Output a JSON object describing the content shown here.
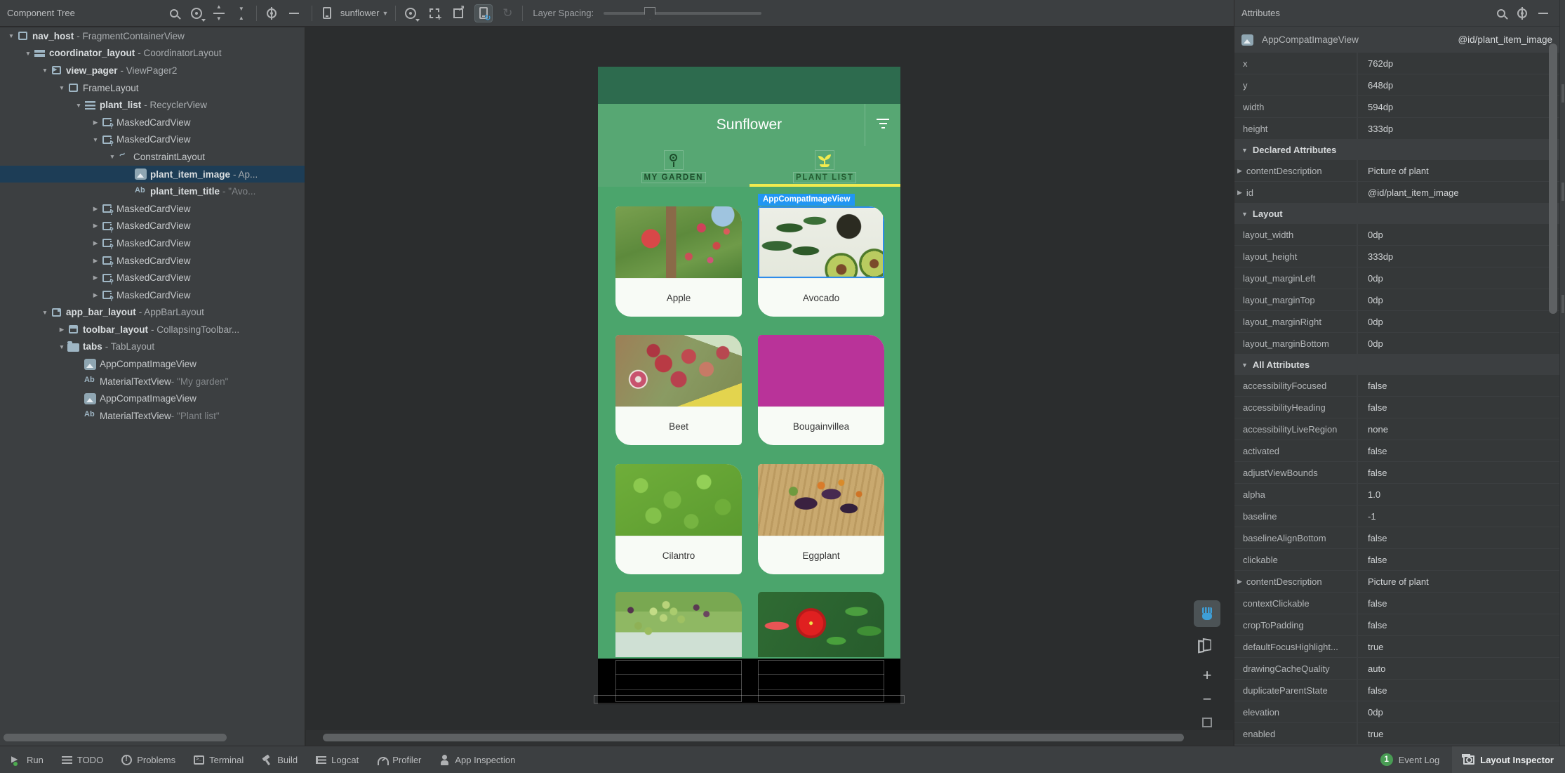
{
  "colors": {
    "panel_bg": "#3c3f41",
    "canvas_bg": "#2b2d2e",
    "selection_blue": "#1d3d56",
    "accent_blue": "#2196f3",
    "app_green": "#4ba56c",
    "appbar_green": "#57a773",
    "statusbar_green": "#2d6b4e",
    "tab_indicator_yellow": "#f0ea4f",
    "badge_green": "#499c54"
  },
  "toolbar": {
    "component_tree_title": "Component Tree",
    "tree_icons": [
      "search-icon",
      "view-options-icon",
      "expand-all-icon",
      "collapse-all-icon",
      "settings-icon",
      "hide-icon"
    ],
    "device_name": "sunflower",
    "center_icons": [
      "view-options-icon",
      "pick-target-icon",
      "export-icon",
      "live-updates-toggle",
      "refresh-icon"
    ],
    "layer_spacing_label": "Layer Spacing:"
  },
  "component_tree": {
    "items": [
      {
        "arrow": "open",
        "icon": "box",
        "label": "nav_host",
        "type": "FragmentContainerView",
        "level": 0
      },
      {
        "arrow": "open",
        "icon": "coord",
        "label": "coordinator_layout",
        "type": "CoordinatorLayout",
        "level": 1
      },
      {
        "arrow": "open",
        "icon": "pager",
        "label": "view_pager",
        "type": "ViewPager2",
        "level": 2
      },
      {
        "arrow": "open",
        "icon": "box",
        "label": "",
        "type": "FrameLayout",
        "level": 3
      },
      {
        "arrow": "open",
        "icon": "list",
        "label": "plant_list",
        "type": "RecyclerView",
        "level": 4
      },
      {
        "arrow": "closed",
        "icon": "card",
        "label": "",
        "type": "MaskedCardView",
        "level": 5
      },
      {
        "arrow": "open",
        "icon": "card",
        "label": "",
        "type": "MaskedCardView",
        "level": 5
      },
      {
        "arrow": "open",
        "icon": "constraint",
        "label": "",
        "type": "ConstraintLayout",
        "level": 6
      },
      {
        "arrow": "none",
        "icon": "img",
        "label": "plant_item_image",
        "type": "Ap...",
        "level": 7,
        "selected": true
      },
      {
        "arrow": "none",
        "icon": "text",
        "label": "plant_item_title",
        "string": "\"Avo...",
        "level": 7
      },
      {
        "arrow": "closed",
        "icon": "card",
        "label": "",
        "type": "MaskedCardView",
        "level": 5
      },
      {
        "arrow": "closed",
        "icon": "card",
        "label": "",
        "type": "MaskedCardView",
        "level": 5
      },
      {
        "arrow": "closed",
        "icon": "card",
        "label": "",
        "type": "MaskedCardView",
        "level": 5
      },
      {
        "arrow": "closed",
        "icon": "card",
        "label": "",
        "type": "MaskedCardView",
        "level": 5
      },
      {
        "arrow": "closed",
        "icon": "card",
        "label": "",
        "type": "MaskedCardView",
        "level": 5
      },
      {
        "arrow": "closed",
        "icon": "card",
        "label": "",
        "type": "MaskedCardView",
        "level": 5
      },
      {
        "arrow": "open",
        "icon": "appbar",
        "label": "app_bar_layout",
        "type": "AppBarLayout",
        "level": 2
      },
      {
        "arrow": "closed",
        "icon": "toolbar",
        "label": "toolbar_layout",
        "type": "CollapsingToolbar...",
        "level": 3
      },
      {
        "arrow": "open",
        "icon": "folder",
        "label": "tabs",
        "type": "TabLayout",
        "level": 3
      },
      {
        "arrow": "none",
        "icon": "img",
        "label": "",
        "type": "AppCompatImageView",
        "level": 4
      },
      {
        "arrow": "none",
        "icon": "text",
        "label": "",
        "type": "MaterialTextView",
        "string": "\"My garden\"",
        "level": 4
      },
      {
        "arrow": "none",
        "icon": "img",
        "label": "",
        "type": "AppCompatImageView",
        "level": 4
      },
      {
        "arrow": "none",
        "icon": "text",
        "label": "",
        "type": "MaterialTextView",
        "string": "\"Plant list\"",
        "level": 4
      }
    ]
  },
  "preview": {
    "app_title": "Sunflower",
    "tabs": [
      {
        "label": "MY GARDEN",
        "icon": "flower-icon",
        "active": false
      },
      {
        "label": "PLANT LIST",
        "icon": "sprout-icon",
        "active": true
      }
    ],
    "selection_label": "AppCompatImageView",
    "cards": [
      {
        "name": "Apple",
        "img": "apple"
      },
      {
        "name": "Avocado",
        "img": "avocado",
        "selected": true
      },
      {
        "name": "Beet",
        "img": "beet"
      },
      {
        "name": "Bougainvillea",
        "img": "bougainvillea"
      },
      {
        "name": "Cilantro",
        "img": "cilantro"
      },
      {
        "name": "Eggplant",
        "img": "eggplant"
      },
      {
        "name": "",
        "img": "grape",
        "partial": true
      },
      {
        "name": "",
        "img": "hibiscus",
        "partial": true
      }
    ]
  },
  "attributes_panel": {
    "title": "Attributes",
    "component": {
      "icon": "image-view-icon",
      "name": "AppCompatImageView",
      "id": "@id/plant_item_image"
    },
    "rows": [
      {
        "kind": "attr",
        "name": "x",
        "value": "762dp"
      },
      {
        "kind": "attr",
        "name": "y",
        "value": "648dp"
      },
      {
        "kind": "attr",
        "name": "width",
        "value": "594dp"
      },
      {
        "kind": "attr",
        "name": "height",
        "value": "333dp"
      },
      {
        "kind": "section",
        "title": "Declared Attributes"
      },
      {
        "kind": "attr",
        "name": "contentDescription",
        "value": "Picture of plant",
        "expandable": true
      },
      {
        "kind": "attr",
        "name": "id",
        "value": "@id/plant_item_image",
        "expandable": true
      },
      {
        "kind": "section",
        "title": "Layout"
      },
      {
        "kind": "attr",
        "name": "layout_width",
        "value": "0dp"
      },
      {
        "kind": "attr",
        "name": "layout_height",
        "value": "333dp"
      },
      {
        "kind": "attr",
        "name": "layout_marginLeft",
        "value": "0dp"
      },
      {
        "kind": "attr",
        "name": "layout_marginTop",
        "value": "0dp"
      },
      {
        "kind": "attr",
        "name": "layout_marginRight",
        "value": "0dp"
      },
      {
        "kind": "attr",
        "name": "layout_marginBottom",
        "value": "0dp"
      },
      {
        "kind": "section",
        "title": "All Attributes"
      },
      {
        "kind": "attr",
        "name": "accessibilityFocused",
        "value": "false"
      },
      {
        "kind": "attr",
        "name": "accessibilityHeading",
        "value": "false"
      },
      {
        "kind": "attr",
        "name": "accessibilityLiveRegion",
        "value": "none"
      },
      {
        "kind": "attr",
        "name": "activated",
        "value": "false"
      },
      {
        "kind": "attr",
        "name": "adjustViewBounds",
        "value": "false"
      },
      {
        "kind": "attr",
        "name": "alpha",
        "value": "1.0"
      },
      {
        "kind": "attr",
        "name": "baseline",
        "value": "-1"
      },
      {
        "kind": "attr",
        "name": "baselineAlignBottom",
        "value": "false"
      },
      {
        "kind": "attr",
        "name": "clickable",
        "value": "false"
      },
      {
        "kind": "attr",
        "name": "contentDescription",
        "value": "Picture of plant",
        "expandable": true
      },
      {
        "kind": "attr",
        "name": "contextClickable",
        "value": "false"
      },
      {
        "kind": "attr",
        "name": "cropToPadding",
        "value": "false"
      },
      {
        "kind": "attr",
        "name": "defaultFocusHighlight...",
        "value": "true"
      },
      {
        "kind": "attr",
        "name": "drawingCacheQuality",
        "value": "auto"
      },
      {
        "kind": "attr",
        "name": "duplicateParentState",
        "value": "false"
      },
      {
        "kind": "attr",
        "name": "elevation",
        "value": "0dp"
      },
      {
        "kind": "attr",
        "name": "enabled",
        "value": "true"
      }
    ]
  },
  "canvas_controls": [
    "pan-tool",
    "3d-mode",
    "zoom-in",
    "zoom-out",
    "zoom-to-fit"
  ],
  "status_bar": {
    "items": [
      {
        "label": "Run",
        "icon": "run"
      },
      {
        "label": "TODO",
        "icon": "todo"
      },
      {
        "label": "Problems",
        "icon": "problems"
      },
      {
        "label": "Terminal",
        "icon": "terminal"
      },
      {
        "label": "Build",
        "icon": "build"
      },
      {
        "label": "Logcat",
        "icon": "logcat"
      },
      {
        "label": "Profiler",
        "icon": "profiler"
      },
      {
        "label": "App Inspection",
        "icon": "inspect"
      }
    ],
    "event_log": {
      "badge": "1",
      "label": "Event Log"
    },
    "layout_inspector_label": "Layout Inspector"
  }
}
